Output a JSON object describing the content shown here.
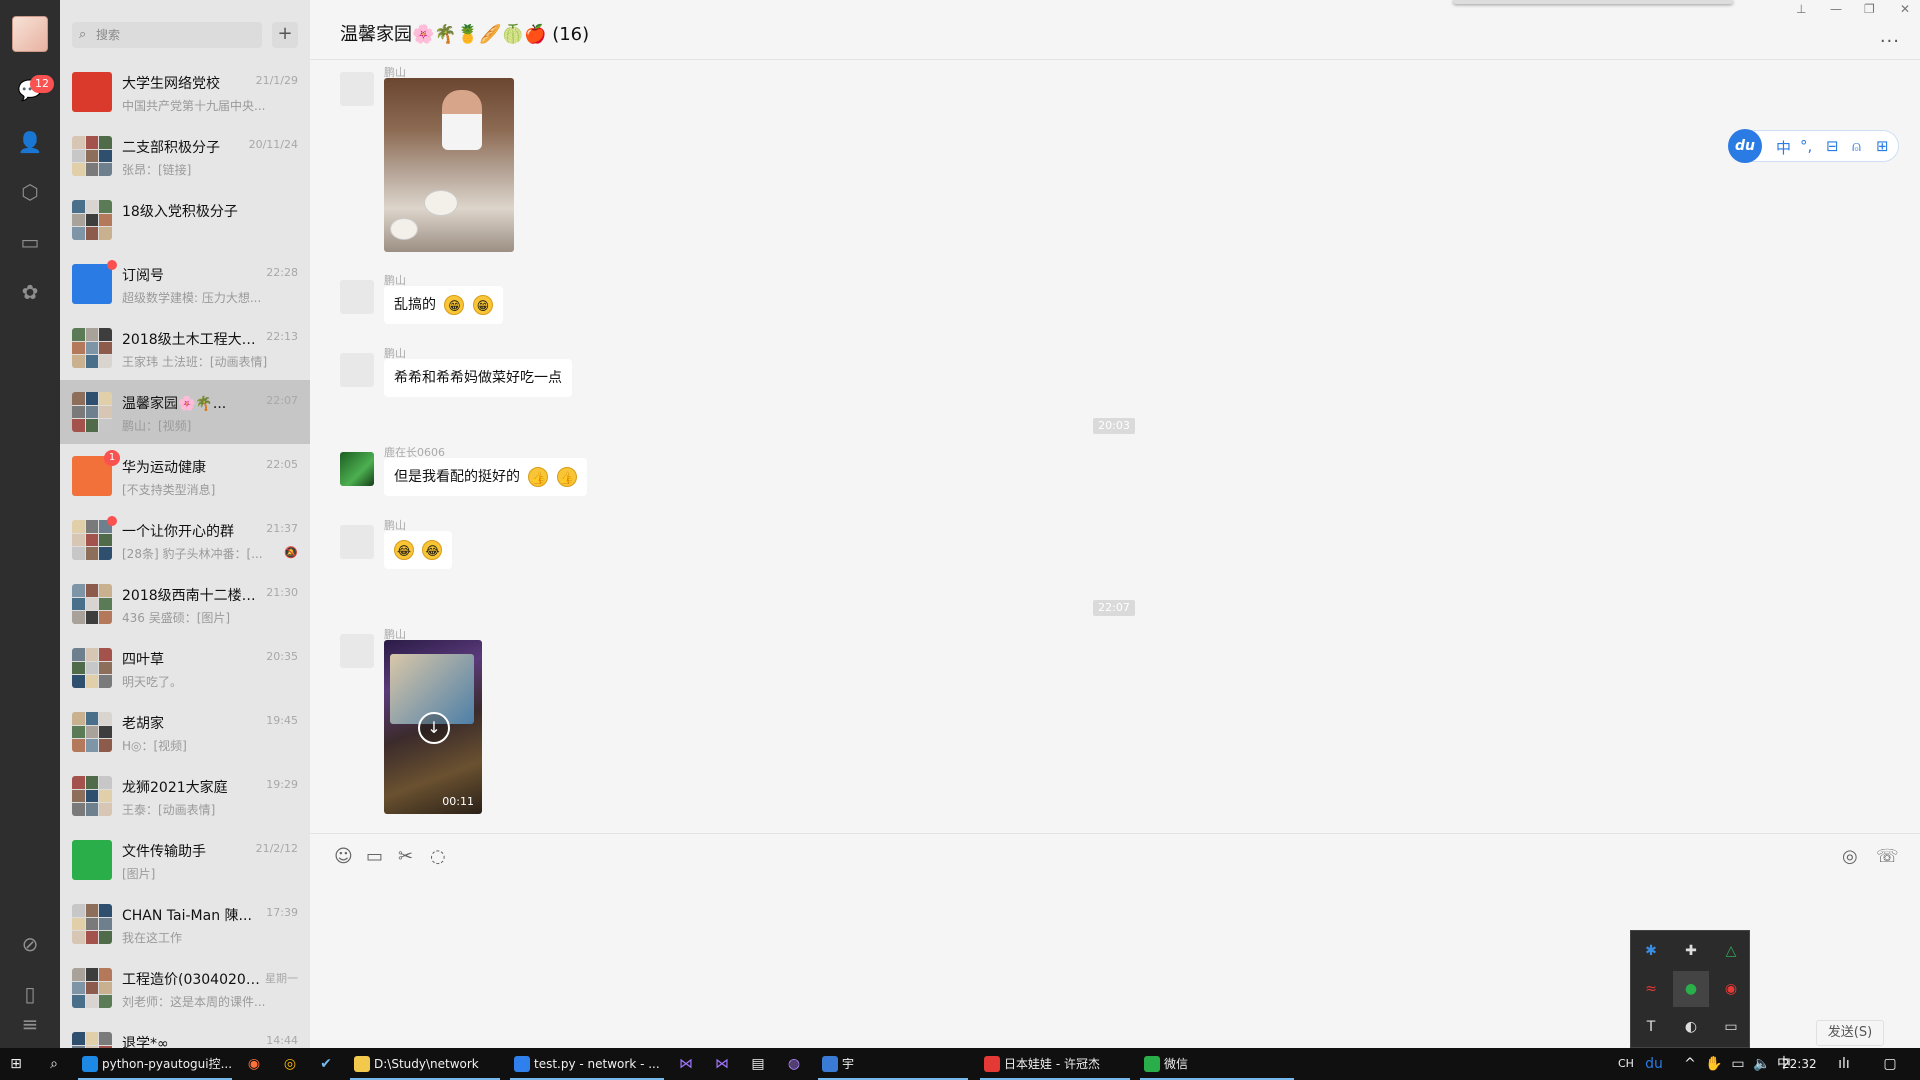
{
  "nav": {
    "badge": "12",
    "icons": [
      "chat-icon",
      "contacts-icon",
      "favorites-icon",
      "files-icon",
      "moments-icon",
      "miniprogram-icon",
      "phone-icon",
      "menu-icon"
    ]
  },
  "search": {
    "placeholder": "搜索",
    "add_label": "+"
  },
  "chats": [
    {
      "name": "大学生网络党校",
      "time": "21/1/29",
      "preview": "中国共产党第十九届中央...",
      "avatar_color": "#d93a2b"
    },
    {
      "name": "二支部积极分子",
      "time": "20/11/24",
      "preview": "张昂：[链接]"
    },
    {
      "name": "18级入党积极分子",
      "time": "",
      "preview": ""
    },
    {
      "name": "订阅号",
      "time": "22:28",
      "preview": "超级数学建模: 压力大想...",
      "avatar_color": "#2b7be4"
    },
    {
      "name": "2018级土木工程大类...",
      "time": "22:13",
      "preview": "王家玮 土法班：[动画表情]"
    },
    {
      "name": "温馨家园🌸🌴...",
      "time": "22:07",
      "preview": "鹏山：[视频]"
    },
    {
      "name": "华为运动健康",
      "time": "22:05",
      "preview": "[不支持类型消息]",
      "badge": "1",
      "avatar_color": "#f2703a"
    },
    {
      "name": "一个让你开心的群",
      "time": "21:37",
      "preview": "[28条] 豹子头林冲番：[...",
      "mute": "🔕"
    },
    {
      "name": "2018级西南十二楼大...",
      "time": "21:30",
      "preview": "436 吴盛硕：[图片]"
    },
    {
      "name": "四叶草",
      "time": "20:35",
      "preview": "明天吃了。"
    },
    {
      "name": "老胡家",
      "time": "19:45",
      "preview": "H◎：[视频]"
    },
    {
      "name": "龙狮2021大家庭",
      "time": "19:29",
      "preview": "王泰：[动画表情]"
    },
    {
      "name": "文件传输助手",
      "time": "21/2/12",
      "preview": "[图片]",
      "avatar_color": "#2aae4a"
    },
    {
      "name": "CHAN Tai-Man 陳...",
      "time": "17:39",
      "preview": "我在这工作"
    },
    {
      "name": "工程造价(03040203...",
      "time": "星期一",
      "preview": "刘老师：这是本周的课件..."
    },
    {
      "name": "退学*∞",
      "time": "14:44",
      "preview": ""
    }
  ],
  "chat": {
    "title": "温馨家园🌸🌴🍍🥖🍈🍎 (16)",
    "more": "...",
    "messages": [
      {
        "sender": "鹏山",
        "type": "image"
      },
      {
        "sender": "鹏山",
        "type": "text",
        "text": "乱搞的",
        "emojis": [
          "😁",
          "😁"
        ]
      },
      {
        "sender": "鹏山",
        "type": "text",
        "text": "希希和希希妈做菜好吃一点"
      },
      {
        "time": "20:03"
      },
      {
        "sender": "鹿在长0606",
        "type": "text",
        "text": "但是我看配的挺好的",
        "emojis": [
          "👍",
          "👍"
        ]
      },
      {
        "sender": "鹏山",
        "type": "text",
        "text": "",
        "emojis": [
          "😂",
          "😂"
        ]
      },
      {
        "time": "22:07"
      },
      {
        "sender": "鹏山",
        "type": "video",
        "duration": "00:11"
      }
    ]
  },
  "ime": {
    "logo": "du",
    "lang": "中",
    "punct": "°,",
    "tools": [
      "toolbox-icon",
      "user-icon",
      "grid-icon"
    ]
  },
  "input_tools": [
    "emoji-icon",
    "folder-icon",
    "scissors-icon",
    "chat-history-icon"
  ],
  "input_right_tools": [
    "live-icon",
    "call-icon"
  ],
  "send_label": "发送(S)",
  "taskbar": {
    "apps": [
      {
        "label": "python-pyautogui控...",
        "color": "#1e88e5"
      },
      {
        "label": "D:\\Study\\network",
        "color": "#f2c94c"
      },
      {
        "label": "test.py - network - ...",
        "color": "#2f80ed"
      },
      {
        "label": "宇",
        "color": "#3a7bd5"
      },
      {
        "label": "日本娃娃 - 许冠杰",
        "color": "#e53935"
      },
      {
        "label": "微信",
        "color": "#2aae4a"
      }
    ],
    "tray_lang": "CH",
    "time": "22:32"
  }
}
